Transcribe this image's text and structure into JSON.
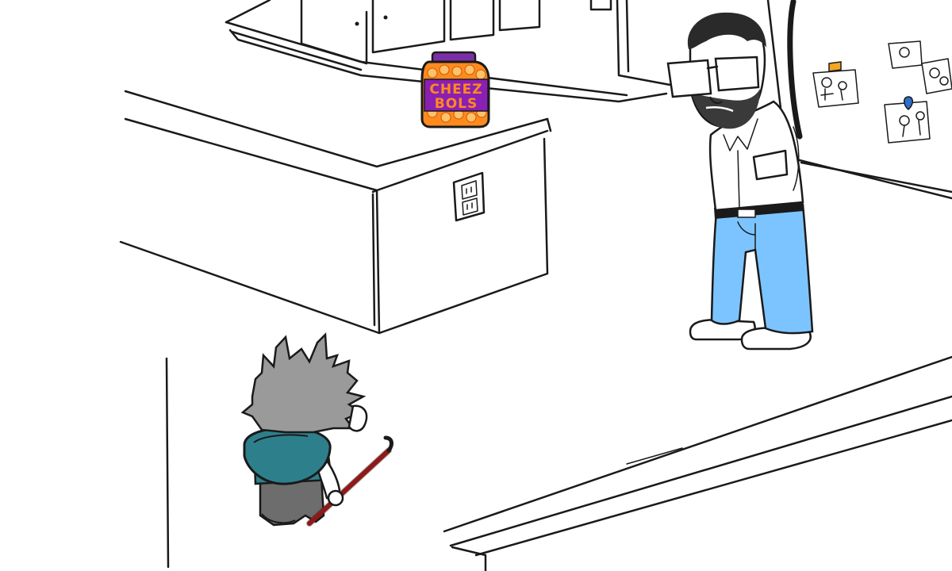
{
  "scene": {
    "type": "comic-panel",
    "setting": "kitchen"
  },
  "jar": {
    "label_line1": "CHEEZ",
    "label_line2": "BOLS",
    "label_color": "#8a1fb3",
    "lid_color": "#7b2fa6",
    "contents_color": "#ff8a1e"
  },
  "colors": {
    "jeans": "#7cc4ff",
    "hood": "#2e7f8c",
    "hair": "#9a9a9a",
    "crowbar": "#cc1a1a",
    "magnet_orange": "#f5a623",
    "magnet_blue": "#2d6fc9"
  },
  "icons": {
    "outlet": "electrical-outlet-icon",
    "magnet_1": "fridge-magnet-icon",
    "magnet_2": "fridge-magnet-icon"
  }
}
